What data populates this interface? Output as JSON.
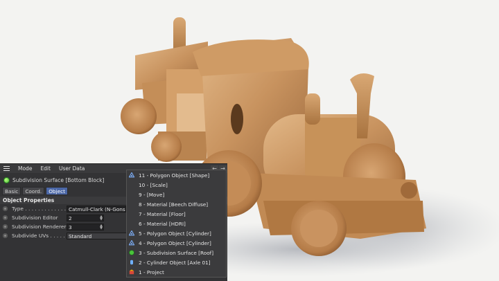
{
  "menu": {
    "items": [
      "Mode",
      "Edit",
      "User Data"
    ]
  },
  "object_title": "Subdivision Surface [Bottom Block]",
  "tabs": [
    {
      "label": "Basic",
      "active": false
    },
    {
      "label": "Coord.",
      "active": false
    },
    {
      "label": "Object",
      "active": true
    }
  ],
  "section_title": "Object Properties",
  "properties": {
    "type": {
      "label": "Type . . . . . . . . . . . . .",
      "value": "Catmull-Clark (N-Gons)"
    },
    "editor": {
      "label": "Subdivision Editor",
      "value": "2"
    },
    "renderer": {
      "label": "Subdivision Renderer",
      "value": "3"
    },
    "uvs": {
      "label": "Subdivide UVs . . . . .",
      "value": "Standard"
    }
  },
  "popup": {
    "items": [
      {
        "label": "11 - Polygon Object [Shape]",
        "icon": "polygon-icon"
      },
      {
        "label": "10 -  [Scale]",
        "icon": ""
      },
      {
        "label": "9 -  [Move]",
        "icon": ""
      },
      {
        "label": "8 - Material [Beech Diffuse]",
        "icon": ""
      },
      {
        "label": "7 - Material [Floor]",
        "icon": ""
      },
      {
        "label": "6 - Material [HDRI]",
        "icon": ""
      },
      {
        "label": "5 - Polygon Object [Cylinder]",
        "icon": "polygon-icon"
      },
      {
        "label": "4 - Polygon Object [Cylinder]",
        "icon": "polygon-icon"
      },
      {
        "label": "3 - Subdivision Surface [Roof]",
        "icon": "subdivision-icon"
      },
      {
        "label": "2 - Cylinder Object [Axle 01]",
        "icon": "cylinder-icon"
      },
      {
        "label": "1 - Project",
        "icon": "project-icon"
      }
    ]
  },
  "colors": {
    "panel_bg": "#333335",
    "active_tab": "#4b67a6",
    "wood_light": "#d7aa78",
    "wood_dark": "#9d6a3e",
    "background": "#f2f2f0"
  }
}
